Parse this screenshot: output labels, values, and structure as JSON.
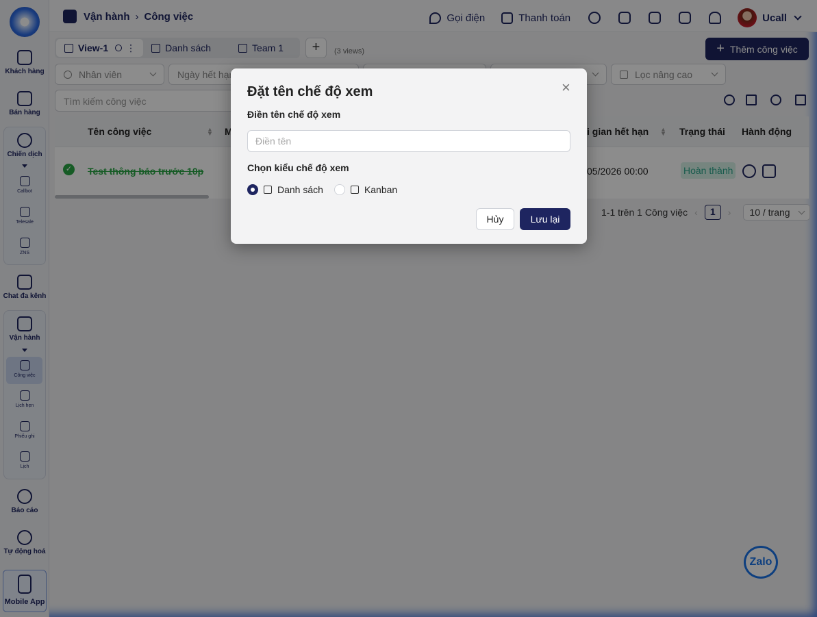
{
  "sidebar": {
    "items": [
      {
        "label": "Khách hàng"
      },
      {
        "label": "Bán hàng"
      },
      {
        "label": "Chiến dịch"
      },
      {
        "label": "Chat đa kênh"
      },
      {
        "label": "Vận hành"
      },
      {
        "label": "Báo cáo"
      },
      {
        "label": "Tự động hoá"
      }
    ],
    "campaign_sub": [
      {
        "label": "Callbot"
      },
      {
        "label": "Telesale"
      },
      {
        "label": "ZNS"
      }
    ],
    "ops_sub": [
      {
        "label": "Công việc"
      },
      {
        "label": "Lịch hẹn"
      },
      {
        "label": "Phiếu ghi"
      },
      {
        "label": "Lịch"
      }
    ],
    "mobile_label": "Mobile App"
  },
  "header": {
    "breadcrumb_root": "Vận hành",
    "breadcrumb_current": "Công việc",
    "call_label": "Gọi điện",
    "payment_label": "Thanh toán",
    "user_name": "Ucall"
  },
  "views": {
    "tabs": [
      {
        "label": "View-1"
      },
      {
        "label": "Danh sách"
      },
      {
        "label": "Team 1"
      }
    ],
    "count": "(3 views)",
    "add_task_label": "Thêm công việc"
  },
  "filters": {
    "employee": "Nhân viên",
    "due_date": "Ngày hết hạn",
    "advanced": "Lọc nâng cao",
    "search_placeholder": "Tìm kiếm công việc"
  },
  "table": {
    "columns": {
      "name": "Tên công việc",
      "col2": "M",
      "due": "i gian hết hạn",
      "status": "Trạng thái",
      "action": "Hành động"
    },
    "rows": [
      {
        "name": "Test thông báo trước 10p",
        "due": "05/2026 00:00",
        "status": "Hoàn thành"
      }
    ]
  },
  "pagination": {
    "summary": "1-1 trên 1 Công việc",
    "current": "1",
    "page_size": "10 / trang"
  },
  "modal": {
    "title": "Đặt tên chế độ xem",
    "name_label": "Điền tên chế độ xem",
    "name_placeholder": "Điền tên",
    "name_value": "",
    "type_label": "Chọn kiểu chế độ xem",
    "option_list": "Danh sách",
    "option_kanban": "Kanban",
    "selected": "Danh sách",
    "cancel_label": "Hủy",
    "save_label": "Lưu lại"
  },
  "zalo_label": "Zalo"
}
